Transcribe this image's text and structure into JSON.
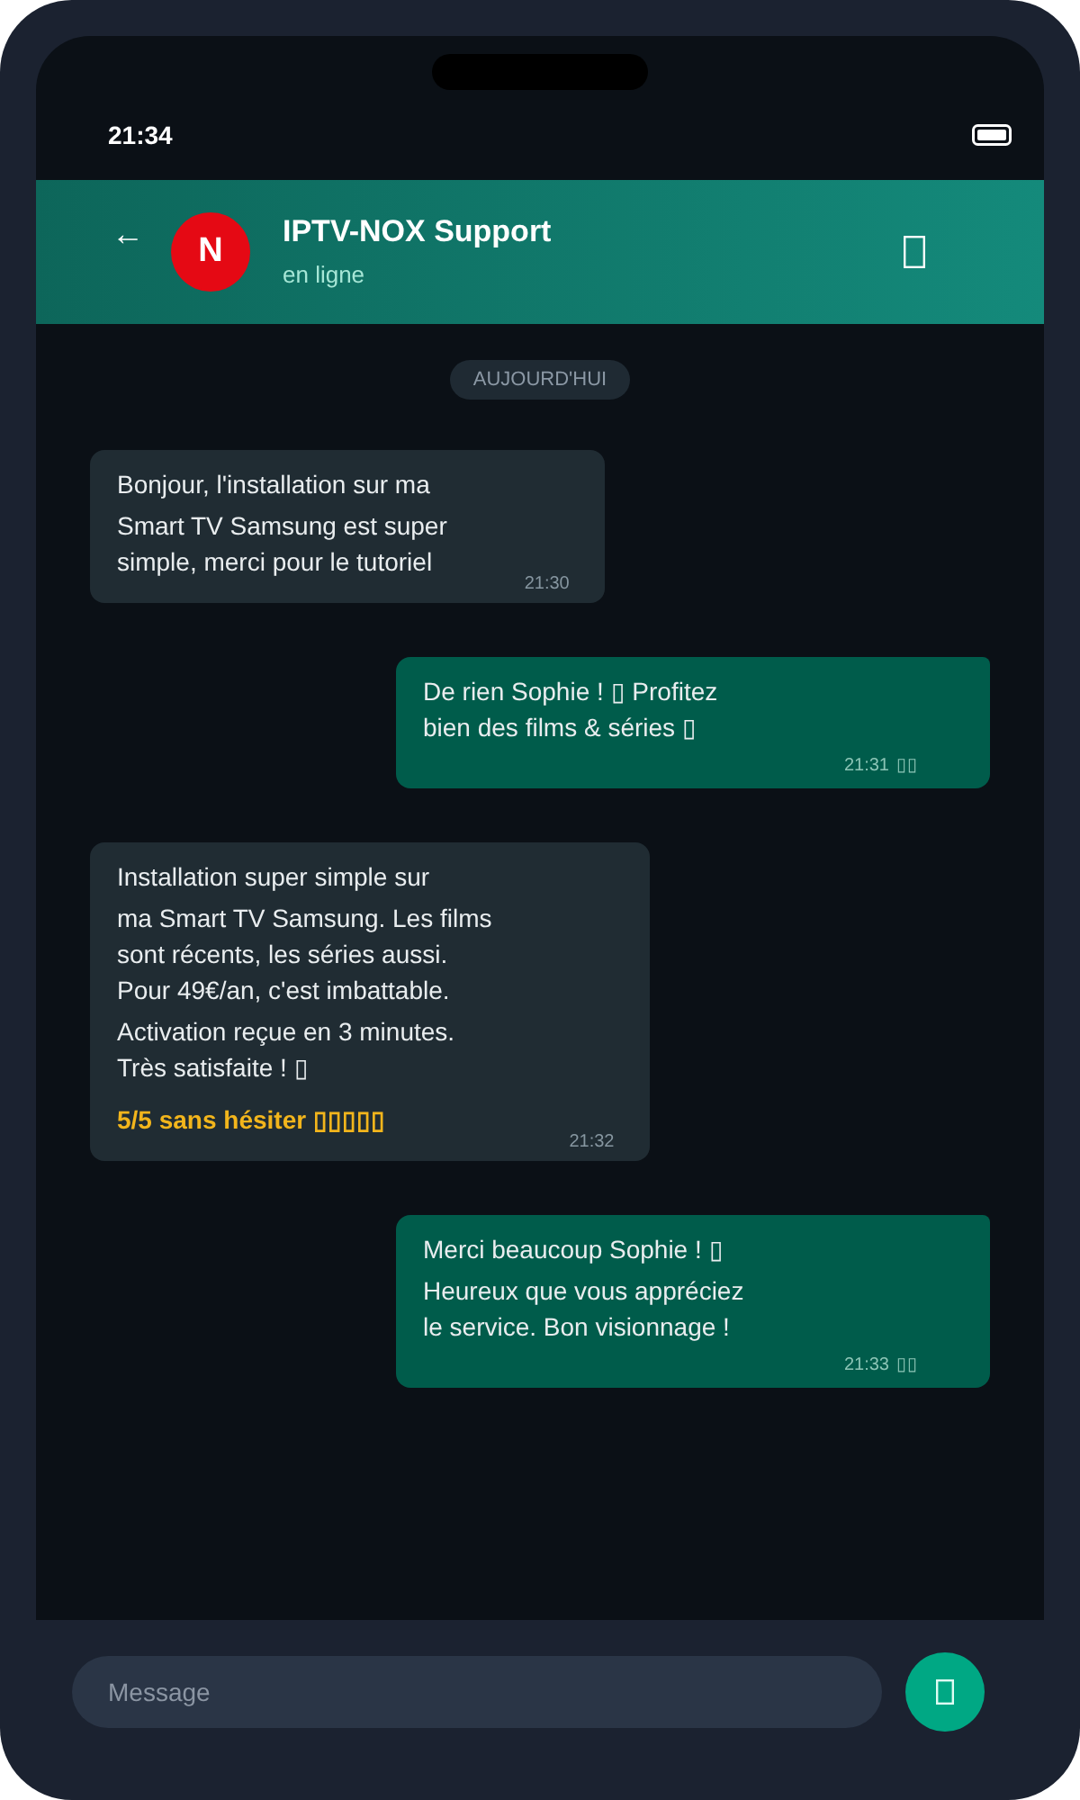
{
  "status_bar": {
    "time": "21:34"
  },
  "header": {
    "back": "←",
    "avatar_letter": "N",
    "name": "IPTV-NOX Support",
    "status": "en ligne"
  },
  "chat": {
    "date_chip": "AUJOURD'HUI",
    "messages": [
      {
        "kind": "incoming",
        "paragraphs": [
          {
            "kind": "text",
            "text": "Bonjour, l'installation sur ma"
          },
          {
            "kind": "text",
            "text": "Smart TV Samsung est super\nsimple, merci pour le tutoriel"
          }
        ],
        "time": "21:30"
      },
      {
        "kind": "outgoing",
        "paragraphs": [
          {
            "kind": "text",
            "text": "De rien Sophie ! ▯ Profitez\nbien des films & séries ▯"
          }
        ],
        "time": "21:31",
        "receipt": "▯▯"
      },
      {
        "kind": "incoming",
        "paragraphs": [
          {
            "kind": "text",
            "text": "Installation super simple sur"
          },
          {
            "kind": "text",
            "text": "ma Smart TV Samsung. Les films\nsont récents, les séries aussi.\nPour 49€/an, c'est imbattable."
          },
          {
            "kind": "text",
            "text": "Activation reçue en 3 minutes.\nTrès satisfaite ! ▯"
          },
          {
            "kind": "rating",
            "text": "5/5 sans hésiter ▯▯▯▯▯"
          }
        ],
        "time": "21:32"
      },
      {
        "kind": "outgoing",
        "paragraphs": [
          {
            "kind": "text",
            "text": "Merci beaucoup Sophie ! ▯"
          },
          {
            "kind": "text",
            "text": "Heureux que vous appréciez\nle service. Bon visionnage !"
          }
        ],
        "time": "21:33",
        "receipt": "▯▯"
      }
    ]
  },
  "composer": {
    "placeholder": "Message"
  }
}
